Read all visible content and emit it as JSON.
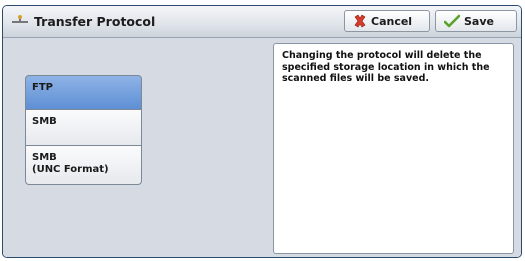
{
  "title": "Transfer Protocol",
  "buttons": {
    "cancel": "Cancel",
    "save": "Save"
  },
  "options": [
    {
      "label": "FTP",
      "selected": true
    },
    {
      "label": "SMB",
      "selected": false
    },
    {
      "label": "SMB\n(UNC Format)",
      "selected": false
    }
  ],
  "message": "Changing the protocol will delete the specified storage location in which the scanned files will be saved.",
  "icons": {
    "title": "transfer-icon",
    "cancel": "red-x-icon",
    "save": "green-check-icon"
  },
  "colors": {
    "selected_option": "#6f9ddc",
    "panel_border": "#2c4a6e",
    "panel_bg": "#d6dbe3"
  }
}
